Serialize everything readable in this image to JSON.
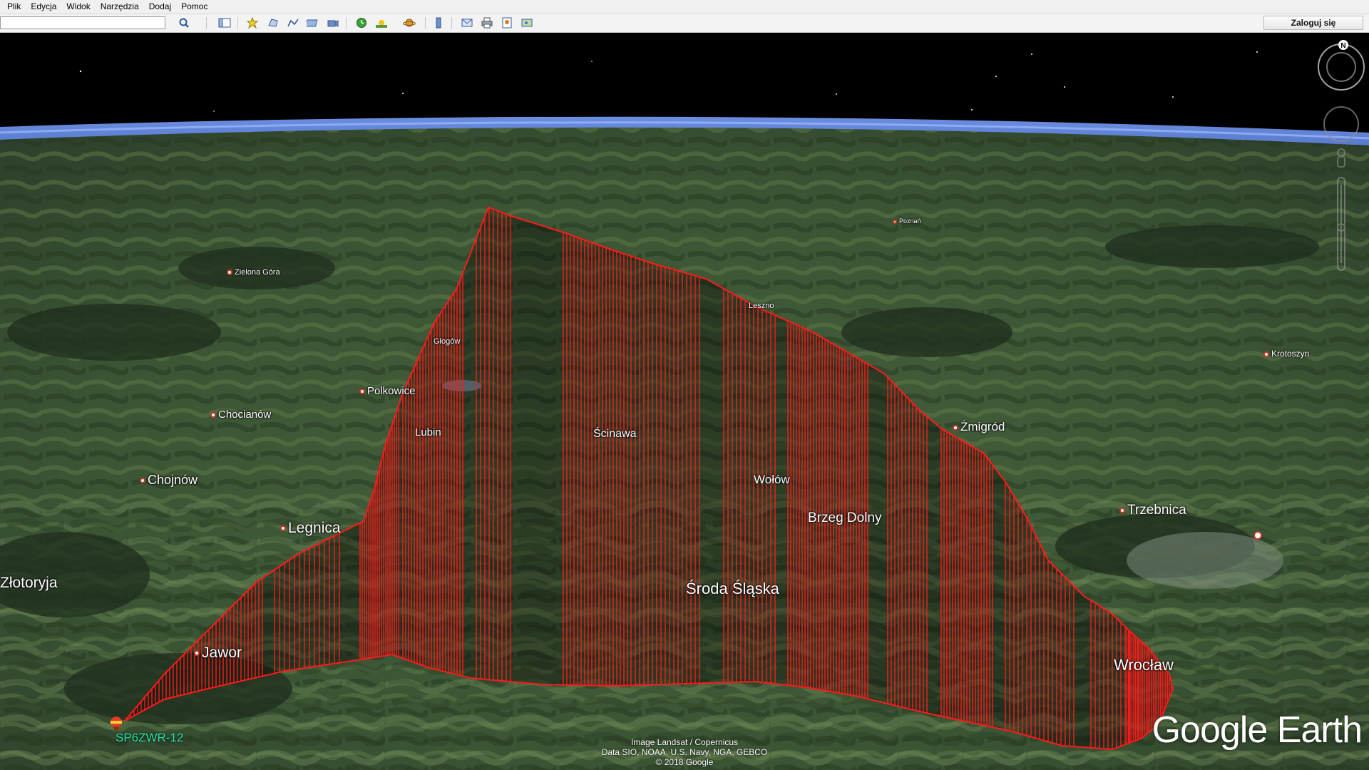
{
  "menu": [
    {
      "id": "plik",
      "label": "Plik"
    },
    {
      "id": "edycja",
      "label": "Edycja"
    },
    {
      "id": "widok",
      "label": "Widok"
    },
    {
      "id": "narzedzia",
      "label": "Narzędzia"
    },
    {
      "id": "dodaj",
      "label": "Dodaj"
    },
    {
      "id": "pomoc",
      "label": "Pomoc"
    }
  ],
  "toolbar": {
    "search_value": "",
    "login_label": "Zaloguj się",
    "icons": [
      "search-icon",
      "sidebar-icon",
      "placemark-icon",
      "polygon-icon",
      "path-icon",
      "image-overlay-icon",
      "tour-icon",
      "historical-imagery-icon",
      "sunlight-icon",
      "planets-icon",
      "ruler-icon",
      "email-icon",
      "print-icon",
      "save-image-icon",
      "maps-icon"
    ]
  },
  "map": {
    "places": [
      {
        "id": "glogow",
        "label": "Głogów",
        "size": "sm",
        "pin": false
      },
      {
        "id": "polkowice",
        "label": "Polkowice",
        "size": "sm",
        "pin": true
      },
      {
        "id": "chocianow",
        "label": "Chocianów",
        "size": "sm",
        "pin": true
      },
      {
        "id": "lubin",
        "label": "Lubin",
        "size": "sm",
        "pin": false
      },
      {
        "id": "chojnow",
        "label": "Chojnów",
        "size": "md",
        "pin": true
      },
      {
        "id": "legnica",
        "label": "Legnica",
        "size": "md",
        "pin": true
      },
      {
        "id": "zlotoryja",
        "label": "Złotoryja",
        "size": "md",
        "pin": false
      },
      {
        "id": "jawor",
        "label": "Jawor",
        "size": "md",
        "pin": true
      },
      {
        "id": "scinawa",
        "label": "Ścinawa",
        "size": "sm",
        "pin": false
      },
      {
        "id": "wolow",
        "label": "Wołów",
        "size": "sm",
        "pin": false
      },
      {
        "id": "brzeg-dolny",
        "label": "Brzeg Dolny",
        "size": "md",
        "pin": false
      },
      {
        "id": "sroda-slaska",
        "label": "Środa Śląska",
        "size": "lg",
        "pin": false
      },
      {
        "id": "wroclaw",
        "label": "Wrocław",
        "size": "lg",
        "pin": false
      },
      {
        "id": "trzebnica",
        "label": "Trzebnica",
        "size": "md",
        "pin": true
      },
      {
        "id": "zmigrod",
        "label": "Żmigród",
        "size": "md",
        "pin": true
      },
      {
        "id": "leszno",
        "label": "Leszno",
        "size": "sm",
        "pin": false
      },
      {
        "id": "zielona-gora",
        "label": "Zielona Góra",
        "size": "sm",
        "pin": true
      },
      {
        "id": "krotoszyn",
        "label": "Krotoszyn",
        "size": "sm",
        "pin": true
      },
      {
        "id": "poznan",
        "label": "Poznań",
        "size": "sm",
        "pin": true
      }
    ],
    "station_label": "SP6ZWR-12",
    "attribution": [
      "Image Landsat / Copernicus",
      "Data SIO, NOAA, U.S. Navy, NGA, GEBCO",
      "© 2018 Google"
    ],
    "logo": "Google Earth",
    "compass_north": "N",
    "colors": {
      "coverage_line": "#ff1a1a",
      "sea": "#5b7fd0",
      "land": "#3c5535",
      "station": "#2ce6a7"
    }
  }
}
